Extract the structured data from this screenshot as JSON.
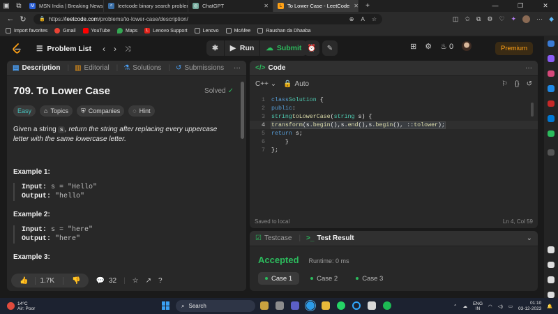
{
  "browser": {
    "tabs": [
      {
        "label": "MSN India | Breaking News, Ente",
        "color": "#2a5fd8",
        "glyph": "M"
      },
      {
        "label": "leetcode binary search problems",
        "color": "#3a6ea5",
        "glyph": "⌕"
      },
      {
        "label": "ChatGPT",
        "color": "#74aa9c",
        "glyph": "◎"
      },
      {
        "label": "To Lower Case - LeetCode",
        "color": "#ffa116",
        "glyph": "L",
        "active": true
      }
    ],
    "new_tab": "+",
    "url_host": "leetcode.com",
    "url_path": "/problems/to-lower-case/description/",
    "bookmarks": [
      {
        "label": "Import favorites",
        "icon": "import-icon",
        "color": "#888"
      },
      {
        "label": "Gmail",
        "icon": "gmail-icon",
        "color": "#ea4335"
      },
      {
        "label": "YouTube",
        "icon": "youtube-icon",
        "color": "#ff0000"
      },
      {
        "label": "Maps",
        "icon": "maps-icon",
        "color": "#34a853"
      },
      {
        "label": "Lenovo Support",
        "icon": "lenovo-icon",
        "color": "#e2231a"
      },
      {
        "label": "Lenovo",
        "icon": "page-icon",
        "color": "#777"
      },
      {
        "label": "McAfee",
        "icon": "page-icon",
        "color": "#777"
      },
      {
        "label": "Raushan da Dhaaba",
        "icon": "page-icon",
        "color": "#777"
      }
    ]
  },
  "nav": {
    "problem_list": "Problem List",
    "run": "Run",
    "submit": "Submit",
    "streak": "0",
    "premium": "Premium"
  },
  "left": {
    "tabs": [
      "Description",
      "Editorial",
      "Solutions",
      "Submissions"
    ],
    "title": "709. To Lower Case",
    "solved": "Solved",
    "chips": [
      "Easy",
      "Topics",
      "Companies",
      "Hint"
    ],
    "desc_pre": "Given a string ",
    "desc_code": "s",
    "desc_post": ", return the string after replacing every uppercase letter with the same lowercase letter.",
    "examples": [
      {
        "title": "Example 1:",
        "input_label": "Input:",
        "input": "s = \"Hello\"",
        "output_label": "Output:",
        "output": "\"hello\""
      },
      {
        "title": "Example 2:",
        "input_label": "Input:",
        "input": "s = \"here\"",
        "output_label": "Output:",
        "output": "\"here\""
      }
    ],
    "example3_title": "Example 3:",
    "likes": "1.7K",
    "comments": "32"
  },
  "code": {
    "header": "Code",
    "language": "C++",
    "mode": "Auto",
    "saved": "Saved to local",
    "position": "Ln 4, Col 59"
  },
  "test": {
    "tab_testcase": "Testcase",
    "tab_result": "Test Result",
    "status": "Accepted",
    "runtime": "Runtime: 0 ms",
    "cases": [
      "Case 1",
      "Case 2",
      "Case 3"
    ]
  },
  "taskbar": {
    "temp": "14°C",
    "air": "Air: Poor",
    "search": "Search",
    "lang1": "ENG",
    "lang2": "IN",
    "time": "01:10",
    "date": "03-12-2023"
  }
}
